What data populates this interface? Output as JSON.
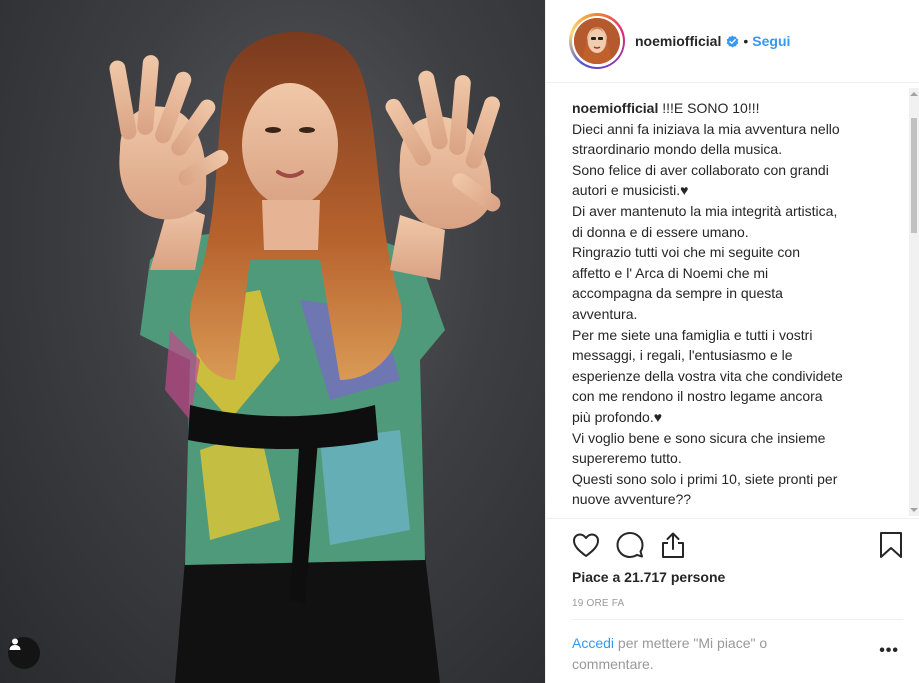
{
  "post": {
    "username": "noemiofficial",
    "separator": "•",
    "follow_label": "Segui"
  },
  "caption": {
    "lines": [
      "!!!E SONO 10!!!",
      "Dieci anni fa iniziava la mia avventura nello",
      "straordinario mondo della musica.",
      "Sono felice di aver collaborato con grandi",
      "autori e musicisti.♥",
      "Di aver mantenuto la mia integrità artistica,",
      "di donna e di essere umano.",
      "Ringrazio tutti voi che mi seguite con",
      "affetto e l' Arca di Noemi che mi",
      "accompagna da sempre in questa",
      "avventura.",
      "Per me siete una famiglia e tutti i vostri",
      "messaggi, i regali, l'entusiasmo e le",
      "esperienze della vostra vita che condividete",
      "con me rendono il nostro legame ancora",
      "più profondo.♥",
      "Vi voglio bene e sono sicura che insieme",
      "supereremo tutto.",
      "Questi sono solo i primi 10, siete pronti per",
      "nuove avventure??"
    ]
  },
  "stats": {
    "likes": "Piace a 21.717 persone",
    "time": "19 ORE FA"
  },
  "comment": {
    "login_link": "Accedi",
    "prompt": " per mettere \"Mi piace\" o commentare.",
    "more_label": "•••"
  },
  "icons": {
    "like": "heart-icon",
    "comment": "comment-icon",
    "share": "share-icon",
    "save": "bookmark-icon",
    "verified": "verified-badge-icon",
    "user_tag": "user-tag-icon"
  },
  "colors": {
    "link": "#3897f0",
    "verified": "#3897f0",
    "muted": "#999999"
  }
}
